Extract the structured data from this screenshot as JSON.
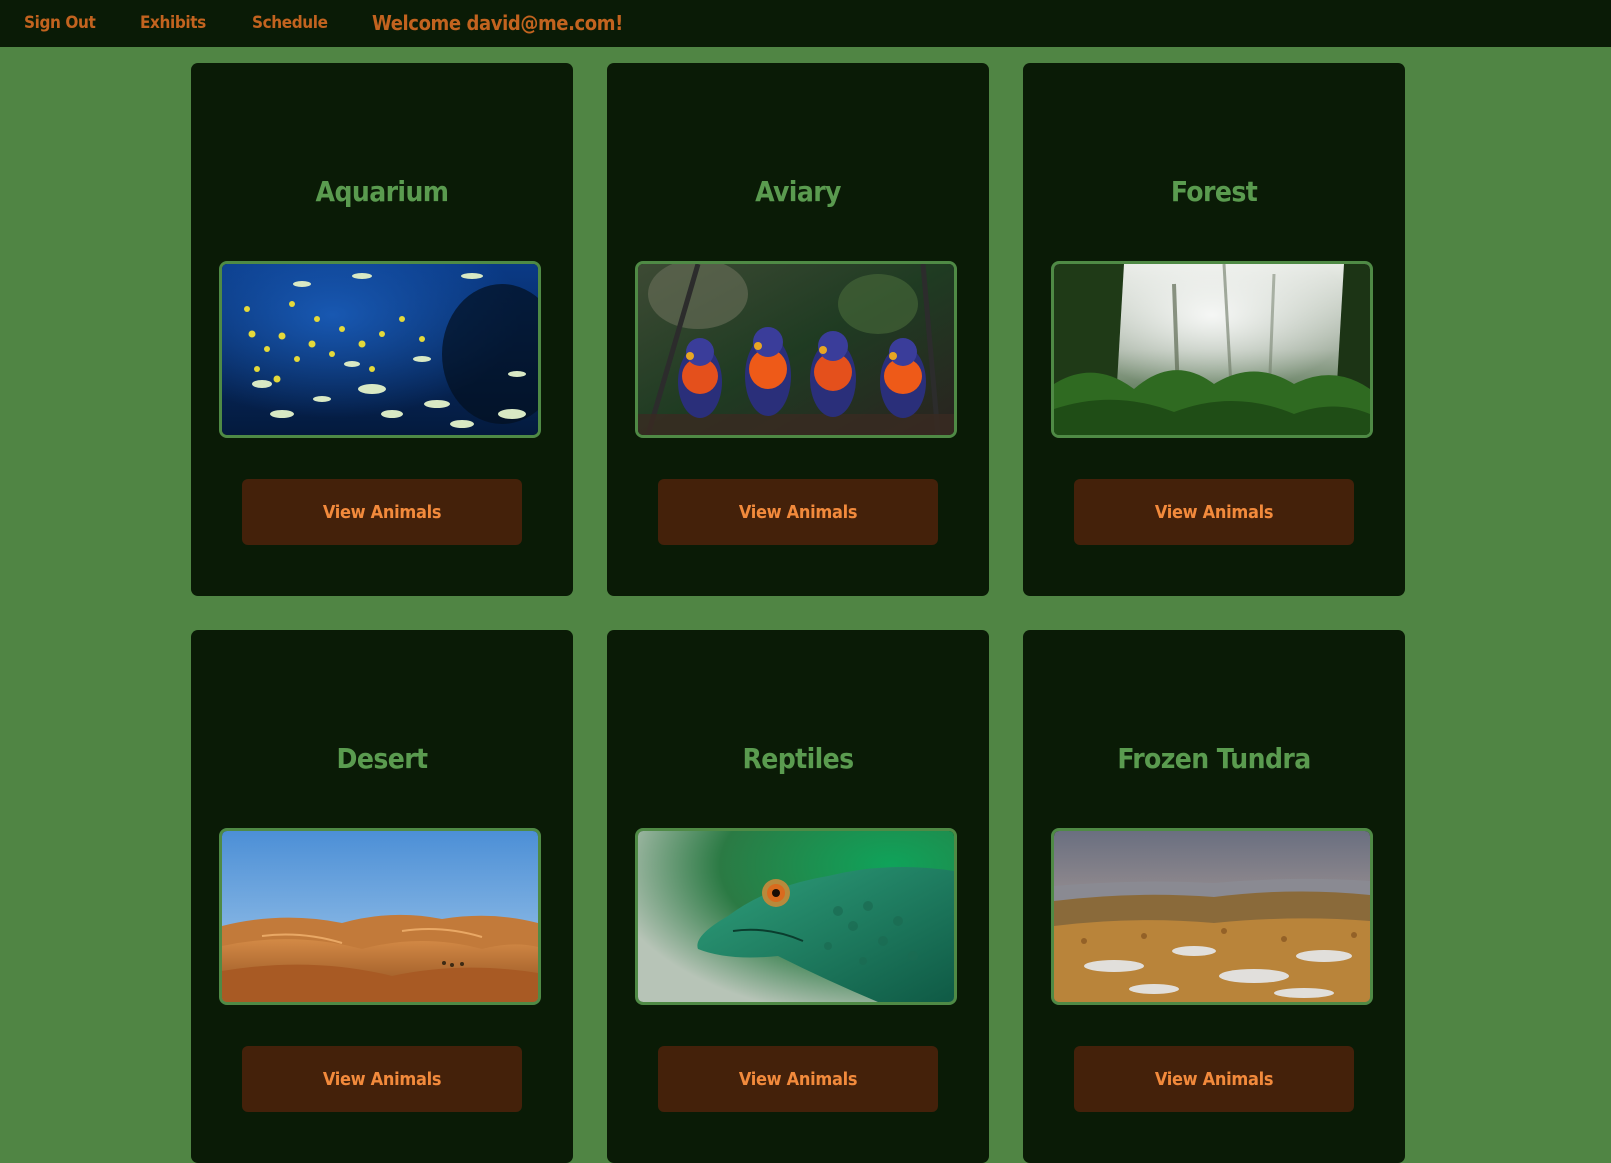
{
  "nav": {
    "sign_out": "Sign Out",
    "exhibits": "Exhibits",
    "schedule": "Schedule",
    "welcome": "Welcome david@me.com!"
  },
  "colors": {
    "page_background": "#508544",
    "nav_background": "#0a1b06",
    "card_background": "#0a1b06",
    "nav_text": "#c2631f",
    "card_title": "#5a9b4f",
    "button_background": "#44210a",
    "button_text": "#f28a3c"
  },
  "exhibits": [
    {
      "title": "Aquarium",
      "image": "aquarium-photo",
      "button_label": "View Animals"
    },
    {
      "title": "Aviary",
      "image": "aviary-photo",
      "button_label": "View Animals"
    },
    {
      "title": "Forest",
      "image": "forest-photo",
      "button_label": "View Animals"
    },
    {
      "title": "Desert",
      "image": "desert-photo",
      "button_label": "View Animals"
    },
    {
      "title": "Reptiles",
      "image": "reptiles-photo",
      "button_label": "View Animals"
    },
    {
      "title": "Frozen Tundra",
      "image": "frozen-tundra-photo",
      "button_label": "View Animals"
    }
  ]
}
